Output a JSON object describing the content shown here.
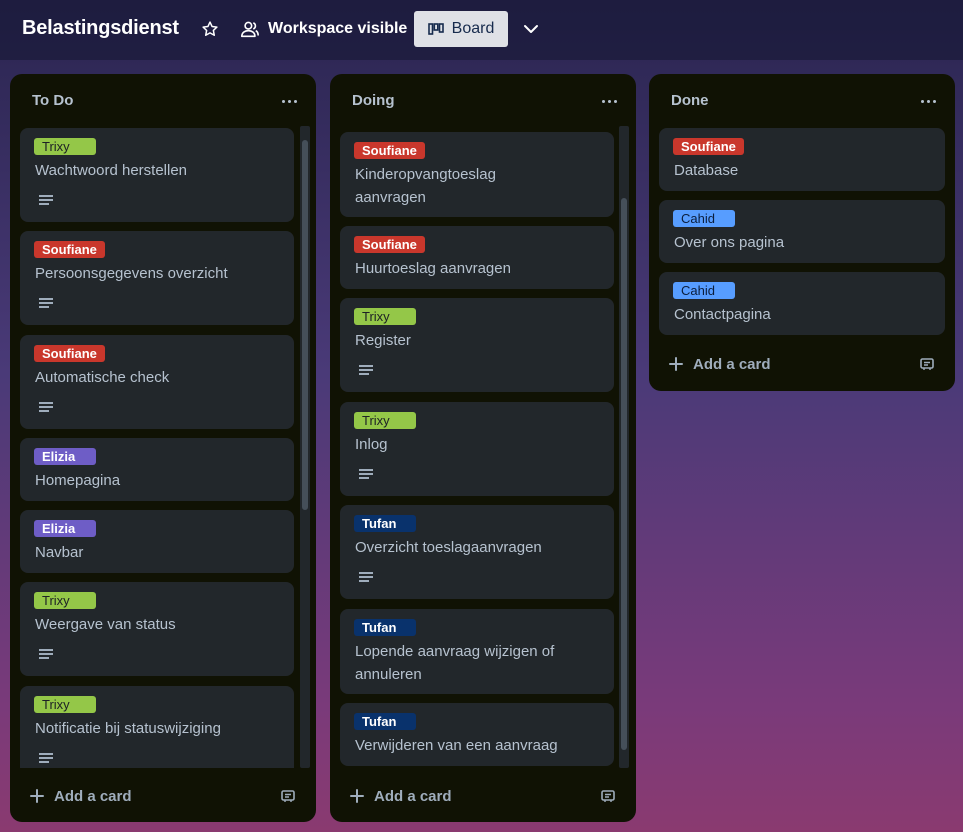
{
  "header": {
    "board_title": "Belastingsdienst",
    "visibility_label": "Workspace visible",
    "view_label": "Board",
    "icons": [
      "star-icon",
      "people-icon",
      "board-view-icon",
      "chevron-down-icon"
    ]
  },
  "colors": {
    "green": "#94c748",
    "red": "#c9372c",
    "purple": "#6e5dc6",
    "blue": "#579dff",
    "navy": "#09326c",
    "list_bg": "#101204",
    "card_bg": "#22272b"
  },
  "lists": [
    {
      "title": "To Do",
      "add_label": "Add a card",
      "cards": [
        {
          "label": "Trixy",
          "label_color": "green",
          "title": "Wachtwoord herstellen",
          "has_description": true
        },
        {
          "label": "Soufiane",
          "label_color": "red",
          "title": "Persoonsgegevens overzicht",
          "has_description": true
        },
        {
          "label": "Soufiane",
          "label_color": "red",
          "title": "Automatische check",
          "has_description": true
        },
        {
          "label": "Elizia",
          "label_color": "purple",
          "title": "Homepagina",
          "has_description": false
        },
        {
          "label": "Elizia",
          "label_color": "purple",
          "title": "Navbar",
          "has_description": false
        },
        {
          "label": "Trixy",
          "label_color": "green",
          "title": "Weergave van status",
          "has_description": true
        },
        {
          "label": "Trixy",
          "label_color": "green",
          "title": "Notificatie bij statuswijziging",
          "has_description": true
        }
      ]
    },
    {
      "title": "Doing",
      "add_label": "Add a card",
      "cards": [
        {
          "label": "Soufiane",
          "label_color": "red",
          "title": "Kinderopvangtoeslag aanvragen",
          "title_lines": [
            "Kinderopvangtoeslag",
            "aanvragen"
          ],
          "has_description": false
        },
        {
          "label": "Soufiane",
          "label_color": "red",
          "title": "Huurtoeslag aanvragen",
          "has_description": false
        },
        {
          "label": "Trixy",
          "label_color": "green",
          "title": "Register",
          "has_description": true
        },
        {
          "label": "Trixy",
          "label_color": "green",
          "title": "Inlog",
          "has_description": true
        },
        {
          "label": "Tufan",
          "label_color": "navy",
          "title": "Overzicht toeslagaanvragen",
          "has_description": true
        },
        {
          "label": "Tufan",
          "label_color": "navy",
          "title": "Lopende aanvraag wijzigen of annuleren",
          "title_lines": [
            "Lopende aanvraag wijzigen of",
            "annuleren"
          ],
          "has_description": false
        },
        {
          "label": "Tufan",
          "label_color": "navy",
          "title": "Verwijderen van een aanvraag",
          "has_description": false
        }
      ]
    },
    {
      "title": "Done",
      "add_label": "Add a card",
      "cards": [
        {
          "label": "Soufiane",
          "label_color": "red",
          "title": "Database",
          "has_description": false
        },
        {
          "label": "Cahid",
          "label_color": "blue",
          "title": "Over ons pagina",
          "has_description": false
        },
        {
          "label": "Cahid",
          "label_color": "blue",
          "title": "Contactpagina",
          "has_description": false
        }
      ]
    }
  ]
}
